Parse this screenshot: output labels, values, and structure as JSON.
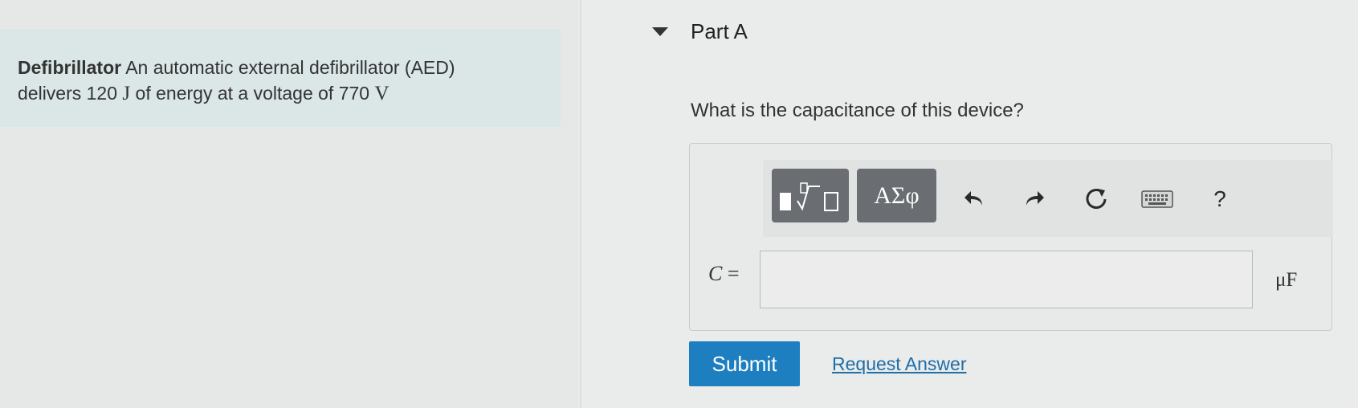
{
  "problem": {
    "title": "Defibrillator",
    "line1_text": "An automatic external defibrillator (AED)",
    "line2_prefix": "delivers 120",
    "energy_unit": "J",
    "line2_middle": "of energy at a voltage of 770",
    "voltage_unit": "V"
  },
  "part": {
    "title": "Part A",
    "question": "What is the capacitance of this device?"
  },
  "toolbar": {
    "templates_icon": "templates-radical-icon",
    "symbols_label": "ΑΣφ",
    "undo_icon": "undo-icon",
    "redo_icon": "redo-icon",
    "reset_icon": "reset-icon",
    "keyboard_icon": "keyboard-icon",
    "help_label": "?"
  },
  "answer": {
    "variable": "C",
    "equals": "=",
    "value": "",
    "unit": "μF"
  },
  "actions": {
    "submit_label": "Submit",
    "request_label": "Request Answer"
  },
  "colors": {
    "submit_bg": "#1d7fc0",
    "link": "#1f6fa8",
    "tool_dark": "#6a6e72",
    "problem_bg": "#dbe6e6"
  }
}
